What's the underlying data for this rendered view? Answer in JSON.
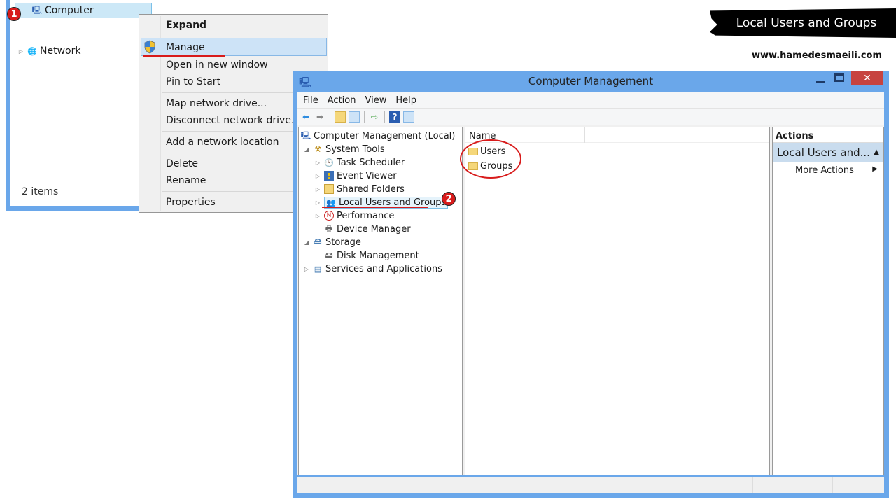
{
  "explorer": {
    "items": [
      {
        "label": "Computer",
        "icon": "computer-icon"
      },
      {
        "label": "Network",
        "icon": "network-icon"
      }
    ],
    "status": "2 items",
    "step_badge": "1"
  },
  "context_menu": {
    "items": [
      {
        "label": "Expand",
        "bold": true
      },
      {
        "label": "Manage",
        "icon": "uac-shield-icon",
        "highlighted": true
      },
      {
        "label": "Open in new window"
      },
      {
        "label": "Pin to Start"
      },
      {
        "label": "Map network drive..."
      },
      {
        "label": "Disconnect network drive..."
      },
      {
        "label": "Add a network location"
      },
      {
        "label": "Delete"
      },
      {
        "label": "Rename"
      },
      {
        "label": "Properties"
      }
    ]
  },
  "overlay": {
    "title": "Local Users and Groups",
    "website": "www.hamedesmaeili.com",
    "step2_badge": "2"
  },
  "computer_management": {
    "title": "Computer Management",
    "menu": [
      "File",
      "Action",
      "View",
      "Help"
    ],
    "toolbar": [
      "back-icon",
      "forward-icon",
      "up-folder-icon",
      "show-hide-tree-icon",
      "export-list-icon",
      "help-icon",
      "show-hide-action-pane-icon"
    ],
    "tree": [
      {
        "label": "Computer Management (Local)",
        "level": 0,
        "twisty": ""
      },
      {
        "label": "System Tools",
        "level": 1,
        "twisty": "expanded"
      },
      {
        "label": "Task Scheduler",
        "level": 2,
        "twisty": "collapsed"
      },
      {
        "label": "Event Viewer",
        "level": 2,
        "twisty": "collapsed"
      },
      {
        "label": "Shared Folders",
        "level": 2,
        "twisty": "collapsed"
      },
      {
        "label": "Local Users and Groups",
        "level": 2,
        "twisty": "collapsed",
        "selected": true
      },
      {
        "label": "Performance",
        "level": 2,
        "twisty": "collapsed"
      },
      {
        "label": "Device Manager",
        "level": 2,
        "twisty": ""
      },
      {
        "label": "Storage",
        "level": 1,
        "twisty": "expanded"
      },
      {
        "label": "Disk Management",
        "level": 2,
        "twisty": ""
      },
      {
        "label": "Services and Applications",
        "level": 1,
        "twisty": "collapsed"
      }
    ],
    "list": {
      "column": "Name",
      "rows": [
        "Users",
        "Groups"
      ]
    },
    "actions": {
      "header": "Actions",
      "group": "Local Users and...",
      "more": "More Actions"
    }
  },
  "colors": {
    "window_frame": "#6aa7ea",
    "close_button": "#c7433f",
    "annotation_red": "#d81b1b",
    "selection": "#cce8f7"
  }
}
